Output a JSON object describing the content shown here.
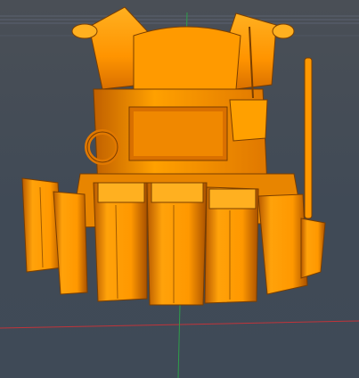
{
  "viewport": {
    "background_color": "#444c57",
    "grid_line_color": "#5a6270",
    "x_axis_color": "#c0343a",
    "y_axis_color": "#2e9e4a"
  },
  "model": {
    "color": "#ff9a00",
    "shadow_color": "#7a3e00",
    "highlight_color": "#ffc040"
  }
}
